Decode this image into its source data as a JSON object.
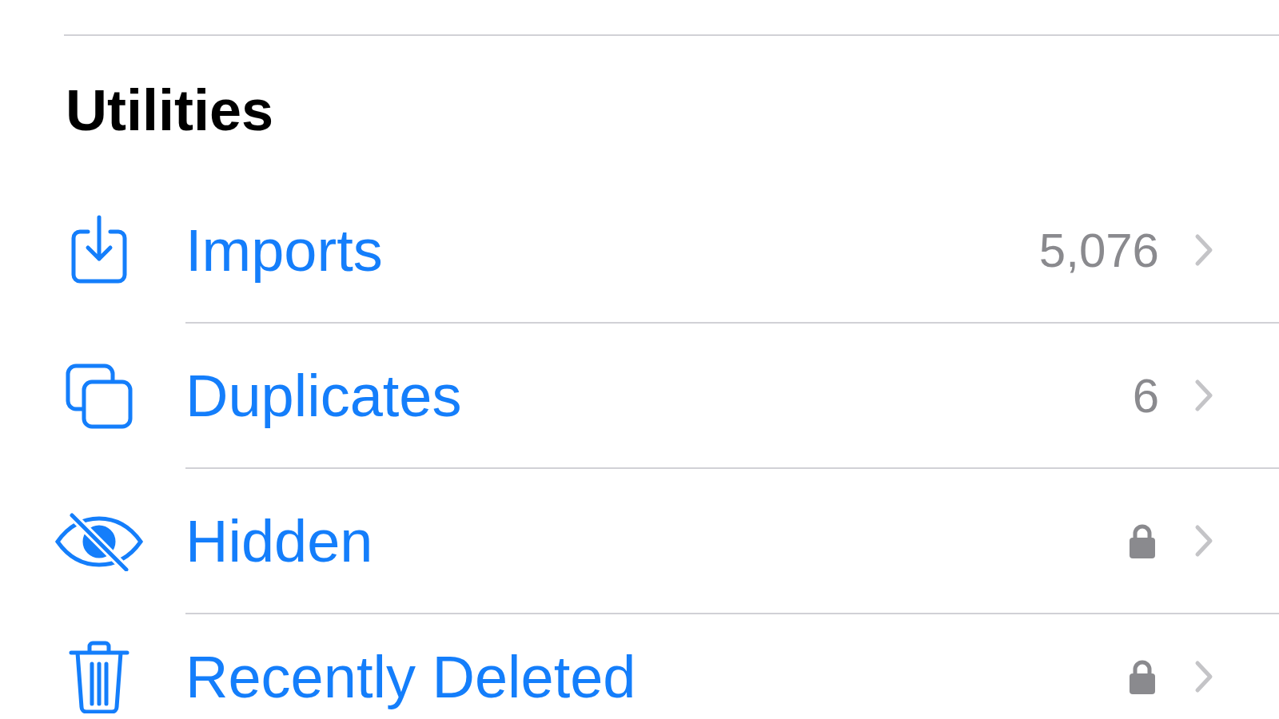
{
  "section": {
    "title": "Utilities"
  },
  "items": [
    {
      "label": "Imports",
      "kind": "count",
      "count": "5,076"
    },
    {
      "label": "Duplicates",
      "kind": "count",
      "count": "6"
    },
    {
      "label": "Hidden",
      "kind": "locked"
    },
    {
      "label": "Recently Deleted",
      "kind": "locked"
    }
  ]
}
